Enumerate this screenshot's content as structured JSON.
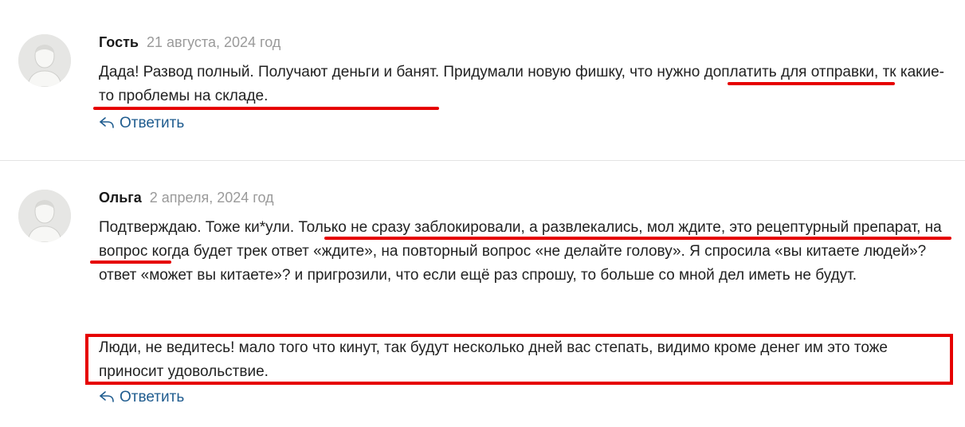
{
  "comments": [
    {
      "author": "Гость",
      "date": "21 августа, 2024 год",
      "text": "Дада! Развод полный. Получают деньги и банят. Придумали новую фишку, что нужно доплатить для отправки, тк какие-то проблемы на складе.",
      "reply_label": "Ответить"
    },
    {
      "author": "Ольга",
      "date": "2 апреля, 2024 год",
      "text": "Подтверждаю. Тоже ки*ули. Только не сразу заблокировали, а развлекались, мол ждите, это рецептурный препарат, на вопрос когда будет трек ответ «ждите», на повторный вопрос «не делайте голову». Я спросила «вы китаете людей»? ответ «может вы китаете»? и пригрозили, что если ещё раз спрошу, то больше со мной дел иметь не будут.",
      "text_highlighted": "Люди, не ведитесь! мало того что кинут, так будут несколько дней вас степать, видимо кроме денег им это тоже приносит удовольствие.",
      "reply_label": "Ответить"
    }
  ],
  "icons": {
    "avatar": "user-avatar-icon",
    "reply": "reply-arrow-icon"
  },
  "colors": {
    "annotation_red": "#e60000",
    "reply_link": "#1f5c8f",
    "date_gray": "#9a9a9a"
  }
}
